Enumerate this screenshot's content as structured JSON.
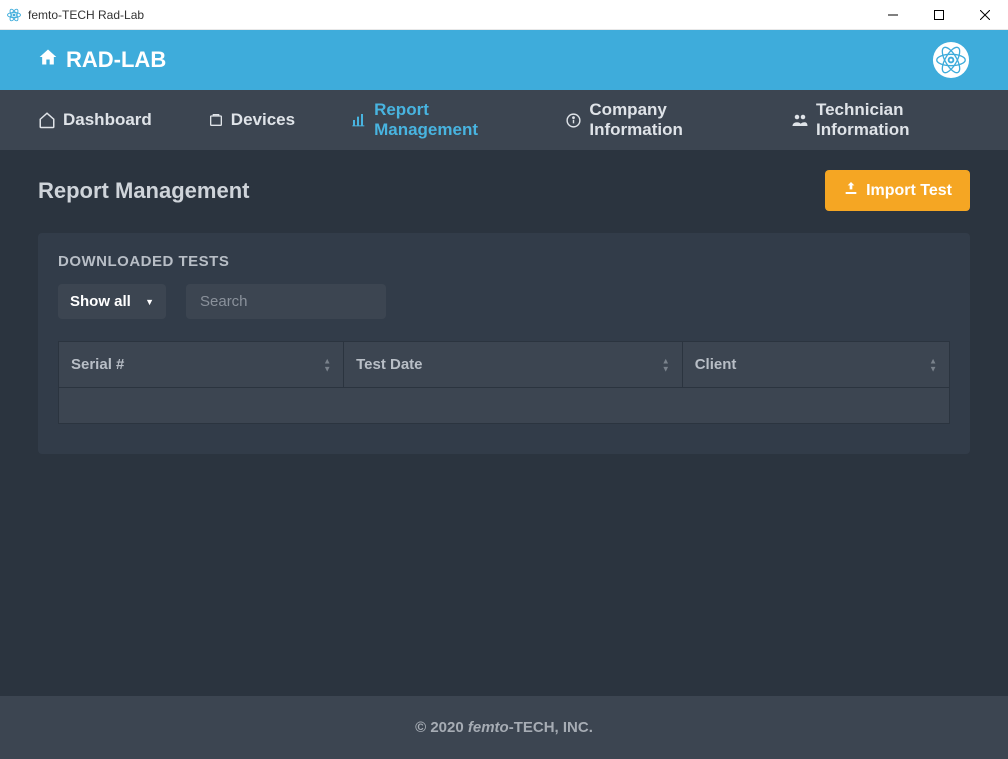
{
  "window": {
    "title": "femto-TECH Rad-Lab"
  },
  "header": {
    "brand": "RAD-LAB"
  },
  "nav": {
    "items": [
      {
        "label": "Dashboard",
        "active": false
      },
      {
        "label": "Devices",
        "active": false
      },
      {
        "label": "Report Management",
        "active": true
      },
      {
        "label": "Company Information",
        "active": false
      },
      {
        "label": "Technician Information",
        "active": false
      }
    ]
  },
  "page": {
    "title": "Report Management",
    "import_label": "Import Test"
  },
  "panel": {
    "title": "DOWNLOADED TESTS",
    "filter_selected": "Show all",
    "search_placeholder": "Search",
    "columns": [
      "Serial #",
      "Test Date",
      "Client"
    ]
  },
  "footer": {
    "copyright_prefix": "© 2020 ",
    "copyright_italic": "femto",
    "copyright_suffix": "-TECH, INC."
  }
}
